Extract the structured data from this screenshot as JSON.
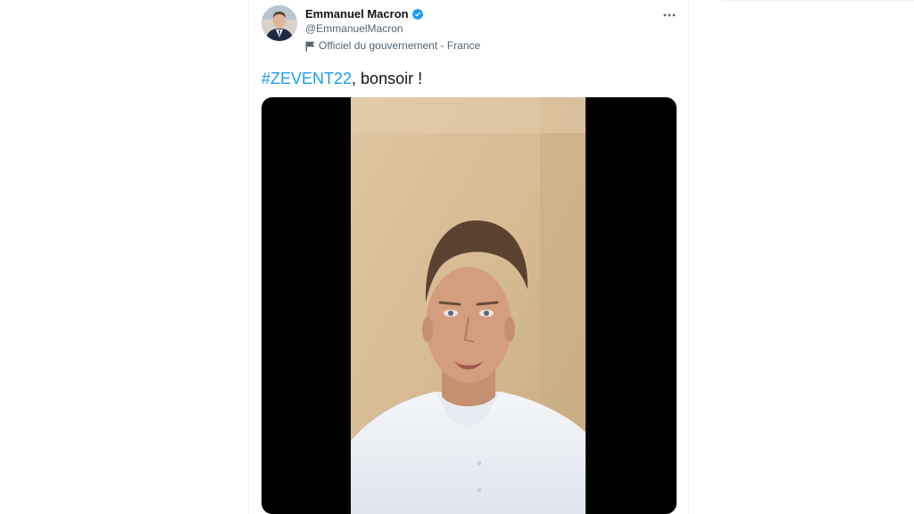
{
  "tweet": {
    "author": {
      "display_name": "Emmanuel Macron",
      "handle": "@EmmanuelMacron",
      "verified": true,
      "verified_icon": "verified-badge-icon",
      "label": "Officiel du gouvernement - France",
      "label_icon": "flag-icon"
    },
    "more_icon": "more-options-icon",
    "text": {
      "hashtag": "#ZEVENT22",
      "rest": ", bonsoir !"
    },
    "media": {
      "type": "video",
      "description_icon": "video-thumbnail"
    }
  },
  "colors": {
    "accent": "#1d9bf0",
    "text_primary": "#0f1419",
    "text_secondary": "#536471",
    "border": "#eff3f4"
  }
}
